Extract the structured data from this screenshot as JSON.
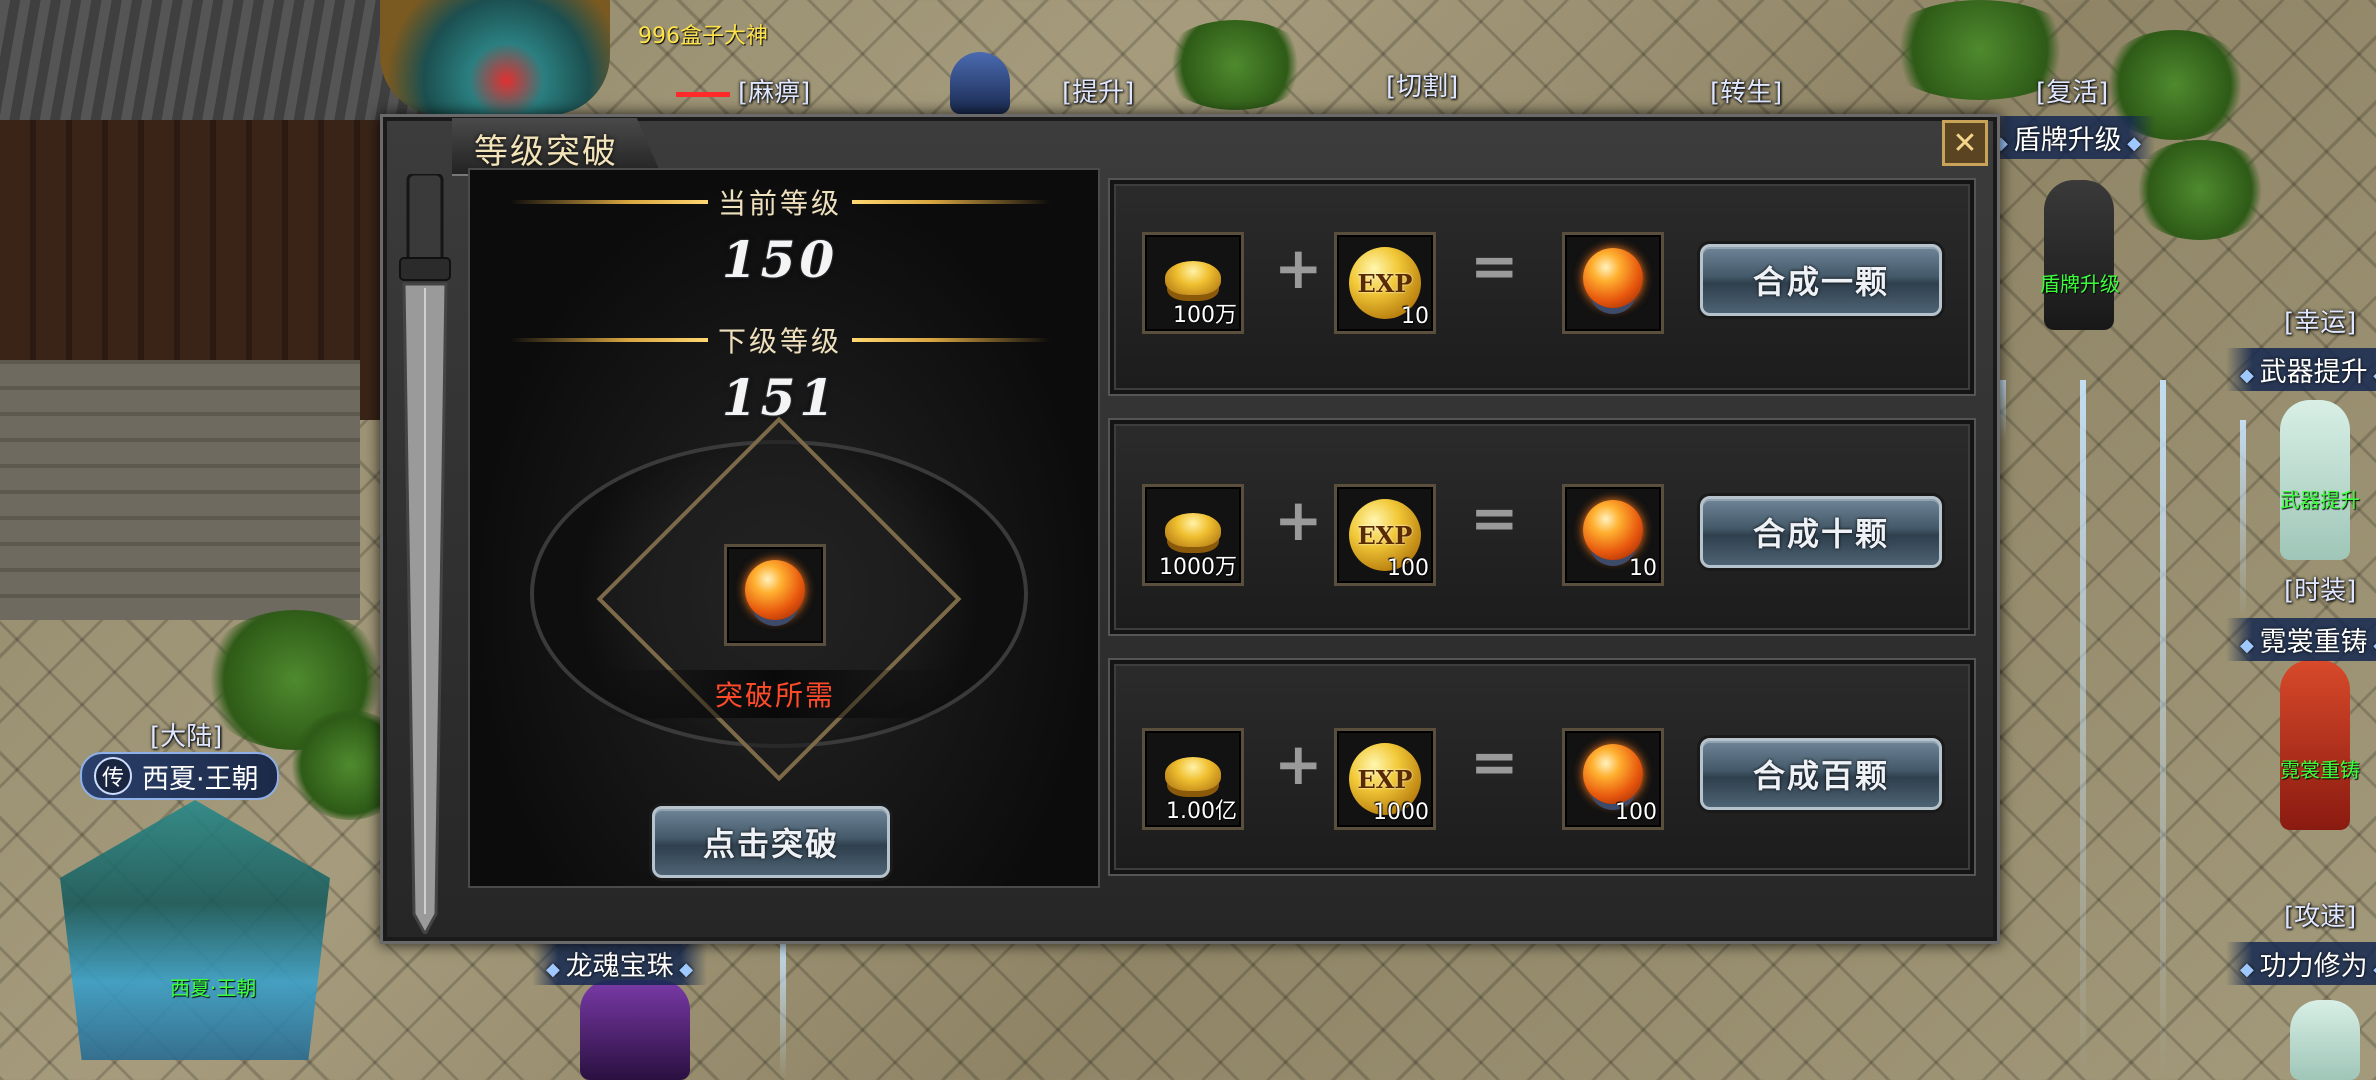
{
  "scene": {
    "player_name": "996盒子大神",
    "npc_labels": [
      "[麻痹]",
      "[提升]",
      "[切割]",
      "[转生]",
      "[复活]",
      "[幸运]",
      "[时装]",
      "[攻速]",
      "[大陆]"
    ],
    "npc_tags": {
      "shield": "盾牌升级",
      "weapon": "武器提升",
      "fashion": "霓裳重铸",
      "power": "功力修为",
      "dragon": "龙魂宝珠"
    },
    "npc_names": {
      "shield": "盾牌升级",
      "weapon": "武器提升",
      "fashion": "霓裳重铸",
      "shrine": "西夏·王朝"
    },
    "map_tag": {
      "badge": "传",
      "name": "西夏·王朝"
    }
  },
  "dialog": {
    "title": "等级突破",
    "current_level_label": "当前等级",
    "current_level": "150",
    "next_level_label": "下级等级",
    "next_level": "151",
    "requirement_label": "突破所需",
    "break_button": "点击突破",
    "recipes": [
      {
        "gold": "100万",
        "exp": "10",
        "result": "",
        "button": "合成一颗"
      },
      {
        "gold": "1000万",
        "exp": "100",
        "result": "10",
        "button": "合成十颗"
      },
      {
        "gold": "1.00亿",
        "exp": "1000",
        "result": "100",
        "button": "合成百颗"
      }
    ],
    "exp_icon_text": "EXP",
    "plus": "+",
    "equals": "="
  },
  "icons": [
    "close-icon",
    "gold-ingot-icon",
    "exp-orb-icon",
    "fire-orb-icon",
    "sword-icon"
  ],
  "colors": {
    "accent_gold": "#d9a640",
    "requirement_red": "#ff4a2a",
    "npc_green": "#3cff3c"
  }
}
